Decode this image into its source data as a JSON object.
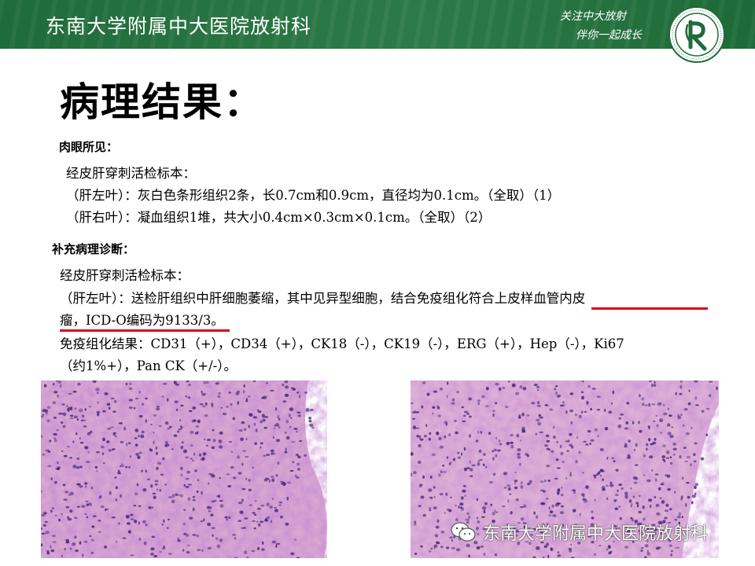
{
  "header": {
    "title": "东南大学附属中大医院放射科",
    "slogan_line1": "关注中大放射",
    "slogan_line2": "伴你一起成长",
    "colors": {
      "band": "#2e7a47",
      "text": "#ffffff"
    }
  },
  "page_title": "病理结果：",
  "gross": {
    "heading": "肉眼所见：",
    "lines": [
      "经皮肝穿刺活检标本：",
      "（肝左叶）：灰白色条形组织2条，长0.7cm和0.9cm，直径均为0.1cm。（全取）（1）",
      "（肝右叶）：凝血组织1堆，共大小0.4cm×0.3cm×0.1cm。（全取）（2）"
    ]
  },
  "supplement": {
    "heading": "补充病理诊断：",
    "lines": [
      "经皮肝穿刺活检标本：",
      "（肝左叶）：送检肝组织中肝细胞萎缩，其中见异型细胞，结合免疫组化符合上皮样血管内皮",
      "瘤，ICD-O编码为9133/3。",
      "免疫组化结果：CD31（+），CD34（+），CK18（-），CK19（-），ERG（+），Hep（-），Ki67",
      "（约1%+），Pan CK（+/-）。"
    ],
    "highlight_color": "#e0001a"
  },
  "images": [
    {
      "name": "histology-left",
      "stain": "HE"
    },
    {
      "name": "histology-right",
      "stain": "HE"
    }
  ],
  "watermark": {
    "icon": "wechat-icon",
    "text": "东南大学附属中大医院放射科"
  }
}
